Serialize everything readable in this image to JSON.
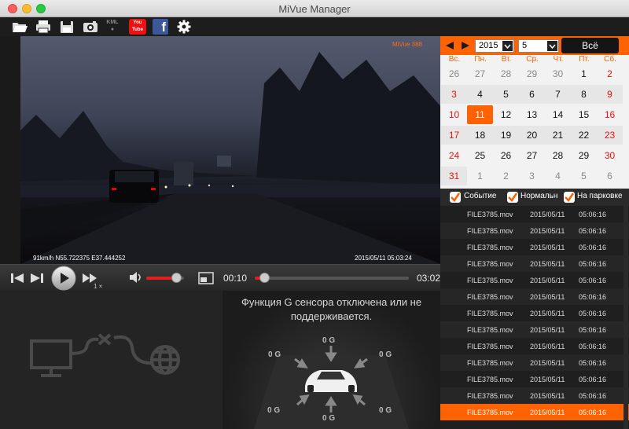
{
  "window": {
    "title": "MiVue Manager"
  },
  "toolbar": {
    "icons": [
      "open-folder-icon",
      "print-icon",
      "save-icon",
      "snapshot-camera-icon",
      "kml-export-icon",
      "youtube-icon",
      "facebook-icon",
      "settings-gear-icon"
    ],
    "kml_label": "KML",
    "youtube_label": "You Tube",
    "facebook_label": "f"
  },
  "video": {
    "model": "MiVue 388",
    "gps_overlay": "91km/h N55.722375 E37.444252",
    "timestamp_overlay": "2015/05/11 05:03:24"
  },
  "player": {
    "current_time": "00:10",
    "total_time": "03:02",
    "speed": "1 ×",
    "volume_level": 0.8,
    "progress": 0.05
  },
  "gsensor": {
    "message_line1": "Функция G сенсора отключена или не",
    "message_line2": "поддерживается.",
    "axis_top": "0 G",
    "axis_left": "0 G",
    "axis_right": "0 G",
    "axis_bottom_left": "0 G",
    "axis_bottom_right": "0 G",
    "axis_bottom": "0 G"
  },
  "calendar": {
    "year": "2015",
    "month": "5",
    "all_button": "Всё",
    "weekdays": [
      "Вс.",
      "Пн.",
      "Вт.",
      "Ср.",
      "Чт.",
      "Пт.",
      "Сб."
    ],
    "weeks": [
      [
        "26",
        "27",
        "28",
        "29",
        "30",
        "1",
        "2"
      ],
      [
        "3",
        "4",
        "5",
        "6",
        "7",
        "8",
        "9"
      ],
      [
        "10",
        "11",
        "12",
        "13",
        "14",
        "15",
        "16"
      ],
      [
        "17",
        "18",
        "19",
        "20",
        "21",
        "22",
        "23"
      ],
      [
        "24",
        "25",
        "26",
        "27",
        "28",
        "29",
        "30"
      ],
      [
        "31",
        "1",
        "2",
        "3",
        "4",
        "5",
        "6"
      ]
    ],
    "selected_day": "11",
    "accent_color": "#ff6200"
  },
  "filters": {
    "event": "Событие",
    "normal": "Нормальн",
    "parking": "На парковке"
  },
  "files": [
    {
      "name": "FILE3785.mov",
      "date": "2015/05/11",
      "time": "05:06:16"
    },
    {
      "name": "FILE3785.mov",
      "date": "2015/05/11",
      "time": "05:06:16"
    },
    {
      "name": "FILE3785.mov",
      "date": "2015/05/11",
      "time": "05:06:16"
    },
    {
      "name": "FILE3785.mov",
      "date": "2015/05/11",
      "time": "05:06:16"
    },
    {
      "name": "FILE3785.mov",
      "date": "2015/05/11",
      "time": "05:06:16"
    },
    {
      "name": "FILE3785.mov",
      "date": "2015/05/11",
      "time": "05:06:16"
    },
    {
      "name": "FILE3785.mov",
      "date": "2015/05/11",
      "time": "05:06:16"
    },
    {
      "name": "FILE3785.mov",
      "date": "2015/05/11",
      "time": "05:06:16"
    },
    {
      "name": "FILE3785.mov",
      "date": "2015/05/11",
      "time": "05:06:16"
    },
    {
      "name": "FILE3785.mov",
      "date": "2015/05/11",
      "time": "05:06:16"
    },
    {
      "name": "FILE3785.mov",
      "date": "2015/05/11",
      "time": "05:06:16"
    },
    {
      "name": "FILE3785.mov",
      "date": "2015/05/11",
      "time": "05:06:16"
    },
    {
      "name": "FILE3785.mov",
      "date": "2015/05/11",
      "time": "05:06:16"
    }
  ]
}
